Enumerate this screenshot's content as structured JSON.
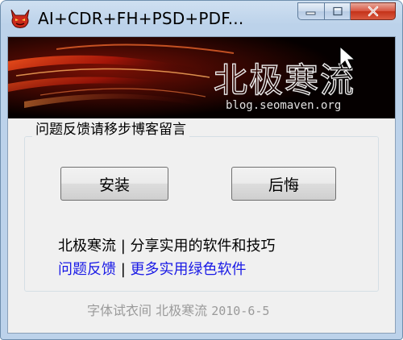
{
  "window": {
    "title": "AI+CDR+FH+PSD+PDF...",
    "minimize_glyph": "—",
    "maximize_glyph": "□",
    "close_glyph": "✕"
  },
  "banner": {
    "logo_text": "北极寒流",
    "url": "blog.seomaven.org"
  },
  "group": {
    "legend": "问题反馈请移步博客留言"
  },
  "buttons": {
    "install": "安装",
    "cancel": "后悔"
  },
  "info": {
    "line1_left": "北极寒流",
    "line1_sep": "|",
    "line1_right": "分享实用的软件和技巧",
    "link_feedback": "问题反馈",
    "line2_sep": "|",
    "link_more": "更多实用绿色软件"
  },
  "footer": {
    "text": "字体试衣间 北极寒流",
    "date": "2010-6-5"
  },
  "colors": {
    "link": "#1a1ae6",
    "banner_bg": "#050000",
    "banner_glow": "#c0200a",
    "close_button": "#c43219"
  },
  "icons": {
    "app": "devil-icon"
  }
}
